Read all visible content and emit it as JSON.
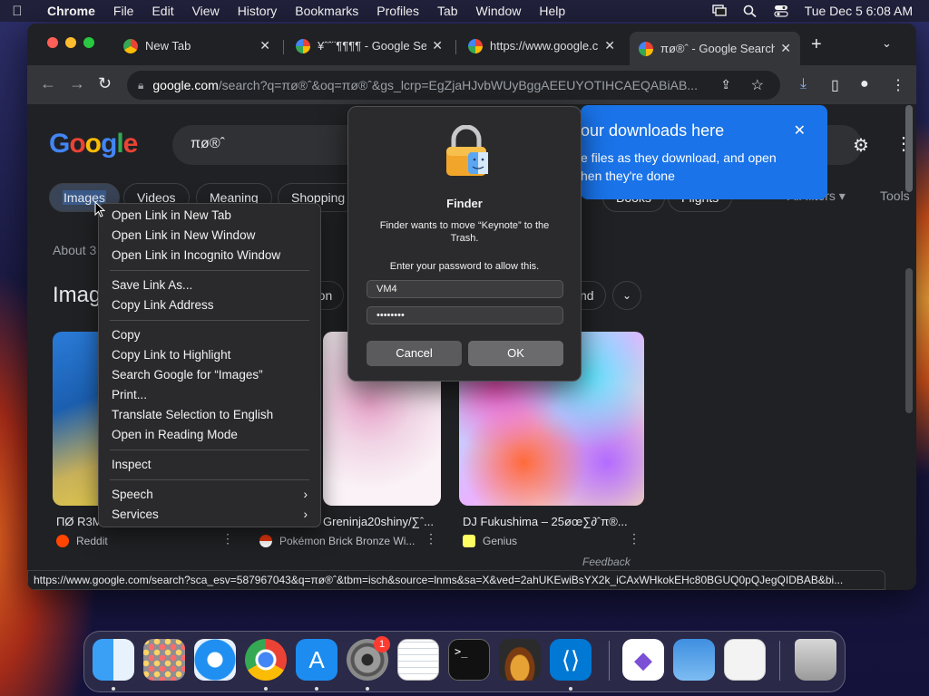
{
  "menubar": {
    "app_name": "Chrome",
    "items": [
      "File",
      "Edit",
      "View",
      "History",
      "Bookmarks",
      "Profiles",
      "Tab",
      "Window",
      "Help"
    ],
    "datetime": "Tue Dec 5  6:08 AM"
  },
  "tabs": [
    {
      "title": "New Tab",
      "active": false
    },
    {
      "title": "¥ˆˆ¨¶¶¶¶ - Google Se",
      "active": false
    },
    {
      "title": "https://www.google.c",
      "active": false
    },
    {
      "title": "πø®ˆ - Google Search",
      "active": true
    }
  ],
  "omnibox": {
    "host": "google.com",
    "path": "/search?q=πø®ˆ&oq=πø®ˆ&gs_lcrp=EgZjaHJvbWUyBggAEEUYOTIHCAEQABiAB..."
  },
  "search": {
    "query": "πø®ˆ",
    "logo_letters": [
      "G",
      "o",
      "o",
      "g",
      "l",
      "e"
    ]
  },
  "chips": [
    "Images",
    "Videos",
    "Meaning",
    "Shopping",
    "Books",
    "Flights",
    "All filters",
    "Tools"
  ],
  "results_count": "About 3",
  "images_heading": "Imag",
  "filter_pills": [
    "mon",
    "nd"
  ],
  "results": [
    {
      "caption": "ΠØ R3M",
      "source": "Reddit",
      "source_color": "#ff4500"
    },
    {
      "caption": "Greninja20shiny/∑ˆ...",
      "source": "Pokémon Brick Bronze Wi...",
      "source_color": "#e3350d"
    },
    {
      "caption": "DJ Fukushima – 25øœ∑∂ˆπ®...",
      "source": "Genius",
      "source_color": "#ffff64"
    }
  ],
  "feedback": "Feedback",
  "status_url": "https://www.google.com/search?sca_esv=587967043&q=πø®ˆ&tbm=isch&source=lnms&sa=X&ved=2ahUKEwiBsYX2k_iCAxWHkokEHc80BGUQ0pQJegQIDBAB&bi...",
  "downloads_bubble": {
    "title": "our downloads here",
    "body_line1": "e files as they download, and open",
    "body_line2": "hen they're done"
  },
  "context_menu": {
    "items": [
      {
        "label": "Open Link in New Tab"
      },
      {
        "label": "Open Link in New Window"
      },
      {
        "label": "Open Link in Incognito Window"
      },
      {
        "label": "Save Link As..."
      },
      {
        "label": "Copy Link Address"
      },
      {
        "label": "Copy"
      },
      {
        "label": "Copy Link to Highlight"
      },
      {
        "label": "Search Google for “Images”"
      },
      {
        "label": "Print..."
      },
      {
        "label": "Translate Selection to English"
      },
      {
        "label": "Open in Reading Mode"
      },
      {
        "label": "Inspect"
      },
      {
        "label": "Speech",
        "submenu": "›"
      },
      {
        "label": "Services",
        "submenu": "›"
      }
    ]
  },
  "dialog": {
    "title": "Finder",
    "message": "Finder wants to move “Keynote” to the Trash.",
    "prompt": "Enter your password to allow this.",
    "username": "VM4",
    "password": "••••••••",
    "cancel": "Cancel",
    "ok": "OK"
  },
  "dock": {
    "apps": [
      "Finder",
      "Launchpad",
      "Safari",
      "Chrome",
      "App Store",
      "System Settings",
      "TextEdit",
      "Terminal",
      "GarageBand",
      "Visual Studio Code",
      "Visual Studio",
      "Weather",
      "Archive Utility",
      "Trash"
    ],
    "settings_badge": "1"
  },
  "colors": {
    "accent": "#1a73e8",
    "dialog_ok": "#6b6b6d",
    "badge": "#ff3b30"
  }
}
